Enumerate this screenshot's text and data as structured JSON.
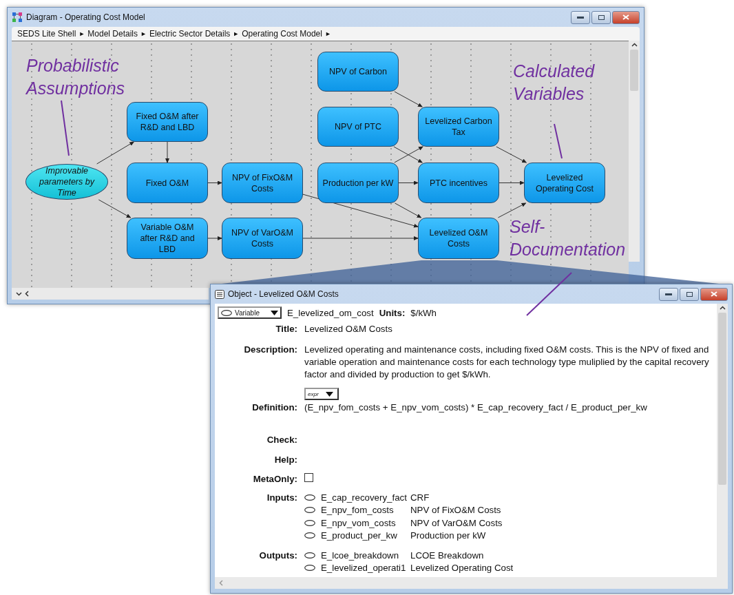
{
  "diagram_window": {
    "title": "Diagram - Operating Cost Model",
    "breadcrumb": [
      "SEDS Lite Shell",
      "Model Details",
      "Electric Sector Details",
      "Operating Cost Model"
    ],
    "separator": "►",
    "nodes": [
      {
        "label": "Improvable parameters by Time",
        "kind": "ellipse"
      },
      {
        "label": "Fixed O&M after R&D and LBD",
        "kind": "box"
      },
      {
        "label": "Fixed O&M",
        "kind": "box"
      },
      {
        "label": "Variable O&M after R&D and LBD",
        "kind": "box"
      },
      {
        "label": "NPV of FixO&M Costs",
        "kind": "box"
      },
      {
        "label": "NPV of VarO&M Costs",
        "kind": "box"
      },
      {
        "label": "NPV of Carbon",
        "kind": "box"
      },
      {
        "label": "NPV of PTC",
        "kind": "box"
      },
      {
        "label": "Production per kW",
        "kind": "box"
      },
      {
        "label": "Levelized Carbon Tax",
        "kind": "box"
      },
      {
        "label": "PTC incentives",
        "kind": "box"
      },
      {
        "label": "Levelized O&M Costs",
        "kind": "box"
      },
      {
        "label": "Levelized Operating Cost",
        "kind": "box"
      }
    ]
  },
  "annotations": [
    "Probabilistic Assumptions",
    "Calculated Variables",
    "Self-Documentation"
  ],
  "object_window": {
    "title": "Object - Levelized O&M Costs",
    "class_dropdown": "Variable",
    "identifier": "E_levelized_om_cost",
    "units_label": "Units:",
    "units": "$/kWh",
    "title_label": "Title:",
    "title_value": "Levelized O&M Costs",
    "description_label": "Description:",
    "description": "Levelized operating and maintenance costs, including fixed O&M costs. This is the NPV of fixed and variable operation and maintenance costs for each technology type muliplied by the capital recovery factor and divided by production to get $/kWh.",
    "definition_dropdown": "expr",
    "definition_label": "Definition:",
    "definition": "(E_npv_fom_costs + E_npv_vom_costs) * E_cap_recovery_fact / E_product_per_kw",
    "check_label": "Check:",
    "help_label": "Help:",
    "metaonly_label": "MetaOnly:",
    "metaonly_checked": false,
    "inputs_label": "Inputs:",
    "inputs": [
      {
        "id": "E_cap_recovery_fact",
        "title": "CRF"
      },
      {
        "id": "E_npv_fom_costs",
        "title": "NPV of FixO&M Costs"
      },
      {
        "id": "E_npv_vom_costs",
        "title": "NPV of VarO&M Costs"
      },
      {
        "id": "E_product_per_kw",
        "title": "Production per kW"
      }
    ],
    "outputs_label": "Outputs:",
    "outputs": [
      {
        "id": "E_lcoe_breakdown",
        "title": "LCOE Breakdown"
      },
      {
        "id": "E_levelized_operati1",
        "title": "Levelized Operating Cost"
      }
    ]
  }
}
